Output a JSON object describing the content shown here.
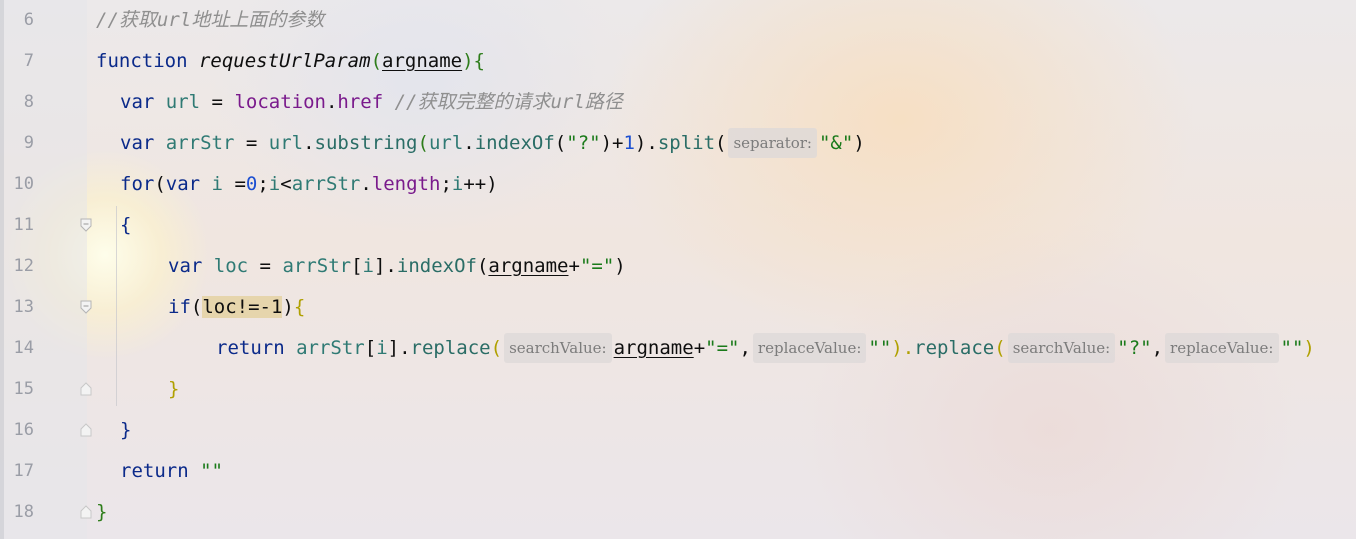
{
  "editor": {
    "lines": [
      {
        "n": "6",
        "tokens": {
          "c1": "//获取url地址上面的参数"
        }
      },
      {
        "n": "7",
        "tokens": {
          "kw": "function",
          "fn": "requestUrlParam",
          "p1": "(",
          "param": "argname",
          "p2": ")",
          "b": "{"
        }
      },
      {
        "n": "8",
        "tokens": {
          "kw": "var",
          "id": "url",
          "eq": " = ",
          "obj": "location",
          "dot": ".",
          "prop": "href",
          "comment": " //获取完整的请求url路径"
        }
      },
      {
        "n": "9",
        "tokens": {
          "kw": "var",
          "id": "arrStr",
          "eq": " = ",
          "u": "url",
          "d1": ".",
          "m1": "substring",
          "o1": "(",
          "u2": "url",
          "d2": ".",
          "m2": "indexOf",
          "o2": "(",
          "s1": "\"?\"",
          "c2": ")+",
          "n1": "1",
          "c3": ").",
          "m3": "split",
          "o3": "(",
          "hint": "separator:",
          "s2": "\"&\"",
          "c4": ")"
        }
      },
      {
        "n": "10",
        "tokens": {
          "kw": "for",
          "o": "(",
          "kw2": "var",
          "i": " i ",
          "eq": "=",
          "n0": "0",
          "s1": ";",
          "i2": "i",
          "lt": "<",
          "a": "arrStr",
          "d": ".",
          "prop": "length",
          "s2": ";",
          "i3": "i",
          "pp": "++)"
        }
      },
      {
        "n": "11",
        "tokens": {
          "b": "{"
        }
      },
      {
        "n": "12",
        "tokens": {
          "kw": "var",
          "id": "loc",
          "eq": " = ",
          "a": "arrStr",
          "br1": "[",
          "i": "i",
          "br2": "].",
          "m": "indexOf",
          "o": "(",
          "param": "argname",
          "plus": "+",
          "s": "\"=\"",
          "c": ")"
        }
      },
      {
        "n": "13",
        "tokens": {
          "kw": "if",
          "o": "(",
          "hl": "loc!=-1",
          "c": ")",
          "b": "{"
        }
      },
      {
        "n": "14",
        "tokens": {
          "kw": "return",
          "a": "arrStr",
          "br1": "[",
          "i": "i",
          "br2": "].",
          "m1": "replace",
          "o1": "(",
          "h1": "searchValue:",
          "param": "argname",
          "plus": "+",
          "s1": "\"=\"",
          "cm1": ",",
          "h2": "replaceValue:",
          "s2": "\"\"",
          "c1": ").",
          "m2": "replace",
          "o2": "(",
          "h3": "searchValue:",
          "s3": "\"?\"",
          "cm2": ",",
          "h4": "replaceValue:",
          "s4": "\"\"",
          "c2": ")"
        }
      },
      {
        "n": "15",
        "tokens": {
          "b": "}"
        }
      },
      {
        "n": "16",
        "tokens": {
          "b": "}"
        }
      },
      {
        "n": "17",
        "tokens": {
          "kw": "return",
          "s": " \"\""
        }
      },
      {
        "n": "18",
        "tokens": {
          "b": "}"
        }
      }
    ]
  }
}
